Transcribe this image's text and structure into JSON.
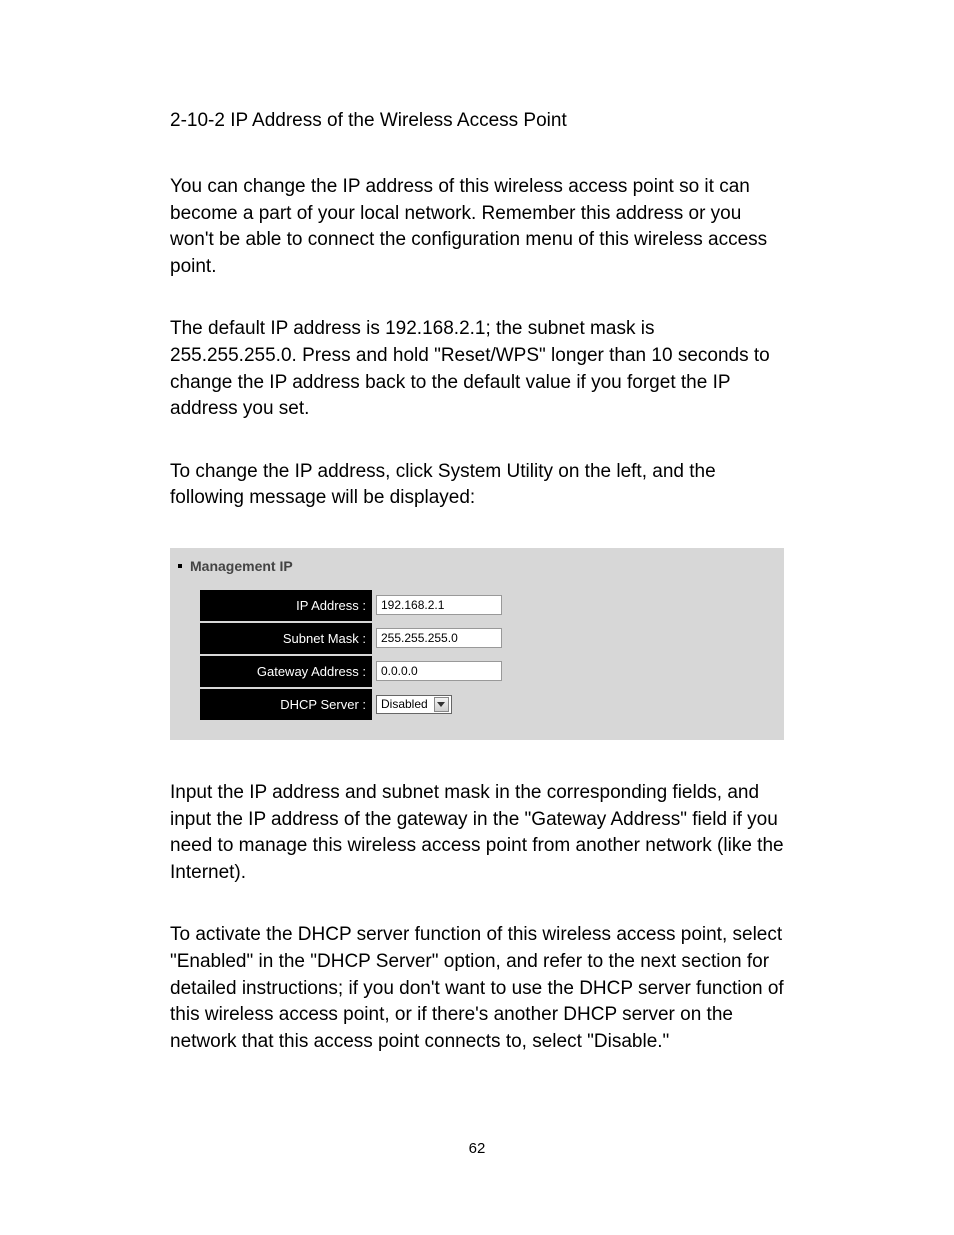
{
  "heading": "2-10-2 IP Address of the Wireless Access Point",
  "para1": "You can change the IP address of this wireless access point so it can become a part of your local network. Remember this address or you won't be able to connect the configuration menu of this wireless access point.",
  "para2": "The default IP address is 192.168.2.1; the subnet mask is 255.255.255.0. Press and hold \"Reset/WPS\" longer than 10 seconds to change the IP address back to the default value if you forget the IP address you set.",
  "para3": "To change the IP address, click System Utility on the left, and the following message will be displayed:",
  "panel": {
    "title": "Management IP",
    "fields": {
      "ip_label": "IP Address :",
      "ip_value": "192.168.2.1",
      "subnet_label": "Subnet Mask :",
      "subnet_value": "255.255.255.0",
      "gateway_label": "Gateway Address :",
      "gateway_value": "0.0.0.0",
      "dhcp_label": "DHCP Server :",
      "dhcp_value": "Disabled"
    }
  },
  "para4": "Input the IP address and subnet mask in the corresponding fields, and input the IP address of the gateway in the \"Gateway Address\" field if you need to manage this wireless access point from another network (like the Internet).",
  "para5": "To activate the DHCP server function of this wireless access point, select \"Enabled\" in the \"DHCP Server\" option, and refer to the next section for detailed instructions; if you don't want to use the DHCP server function of this wireless access point, or if there's another DHCP server on the network that this access point connects to, select \"Disable.\"",
  "pagenum": "62"
}
